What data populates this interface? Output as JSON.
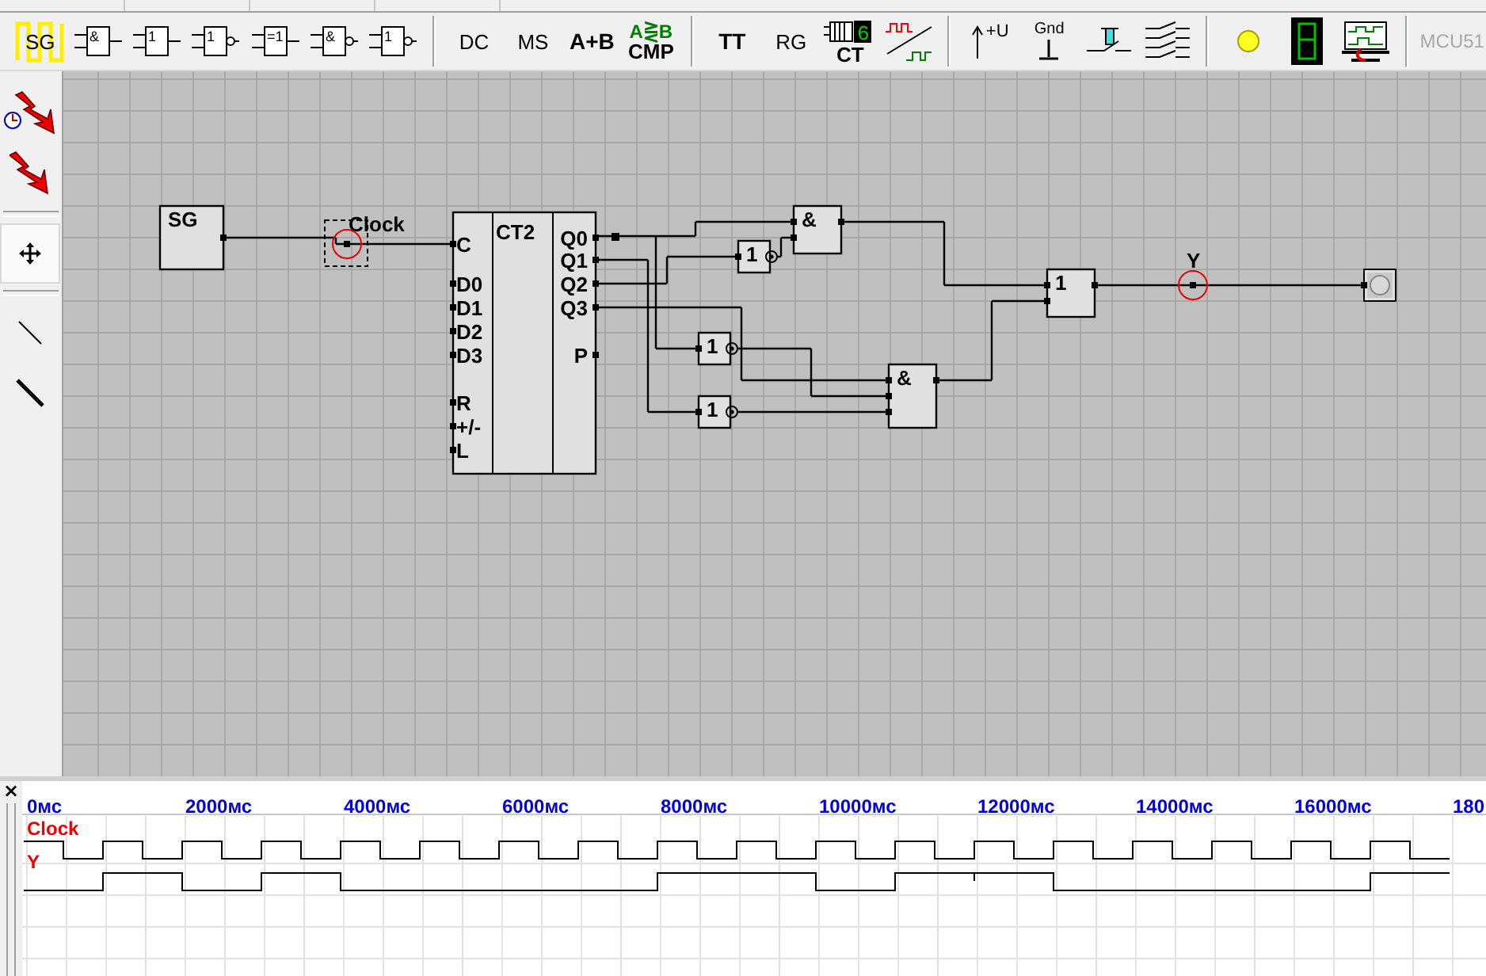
{
  "toolbar": {
    "items": [
      {
        "kind": "generator",
        "label": "SG"
      },
      {
        "kind": "and",
        "label": "&"
      },
      {
        "kind": "or",
        "label": "1"
      },
      {
        "kind": "not",
        "label": "1"
      },
      {
        "kind": "xor",
        "label": "=1"
      },
      {
        "kind": "nand",
        "label": "&"
      },
      {
        "kind": "nor",
        "label": "1"
      },
      {
        "kind": "separator"
      },
      {
        "kind": "text",
        "label": "DC"
      },
      {
        "kind": "text",
        "label": "MS"
      },
      {
        "kind": "bold",
        "label": "A+B"
      },
      {
        "kind": "comparator",
        "label": "A⋛B",
        "sublabel": "CMP"
      },
      {
        "kind": "separator"
      },
      {
        "kind": "bold",
        "label": "TT"
      },
      {
        "kind": "text",
        "label": "RG"
      },
      {
        "kind": "counter",
        "digit": "6",
        "label": "CT"
      },
      {
        "kind": "converter"
      },
      {
        "kind": "separator"
      },
      {
        "kind": "power",
        "label": "+U"
      },
      {
        "kind": "ground",
        "label": "Gnd"
      },
      {
        "kind": "switch"
      },
      {
        "kind": "multiswitch"
      },
      {
        "kind": "separator"
      },
      {
        "kind": "lamp"
      },
      {
        "kind": "display"
      },
      {
        "kind": "scope"
      },
      {
        "kind": "separator"
      },
      {
        "kind": "text",
        "label": "MCU51",
        "disabled": true
      }
    ]
  },
  "tools": [
    {
      "kind": "clock-probe",
      "selected": false
    },
    {
      "kind": "probe",
      "selected": false
    },
    {
      "kind": "separator"
    },
    {
      "kind": "move",
      "selected": true
    },
    {
      "kind": "separator"
    },
    {
      "kind": "thin-line",
      "selected": false
    },
    {
      "kind": "thick-line",
      "selected": false
    }
  ],
  "circuit": {
    "components": [
      {
        "kind": "generator",
        "label": "SG"
      },
      {
        "kind": "probe",
        "label": "Clock",
        "selected": true
      },
      {
        "kind": "counter",
        "title": "CT2",
        "inputs": [
          "C",
          "D0",
          "D1",
          "D2",
          "D3",
          "R",
          "+/-",
          "L"
        ],
        "outputs": [
          "Q0",
          "Q1",
          "Q2",
          "Q3",
          "P"
        ]
      },
      {
        "kind": "and",
        "label": "&"
      },
      {
        "kind": "not",
        "label": "1"
      },
      {
        "kind": "not",
        "label": "1"
      },
      {
        "kind": "not",
        "label": "1"
      },
      {
        "kind": "and",
        "label": "&"
      },
      {
        "kind": "or",
        "label": "1"
      },
      {
        "kind": "probe",
        "label": "Y",
        "selected": false
      },
      {
        "kind": "lamp"
      }
    ]
  },
  "timing": {
    "close": "×",
    "ticks": [
      "0мс",
      "2000мс",
      "4000мс",
      "6000мс",
      "8000мс",
      "10000мс",
      "12000мс",
      "14000мс",
      "16000мс",
      "180"
    ],
    "signals": [
      {
        "name": "Clock",
        "kind": "clock"
      },
      {
        "name": "Y",
        "kind": "output"
      }
    ]
  }
}
